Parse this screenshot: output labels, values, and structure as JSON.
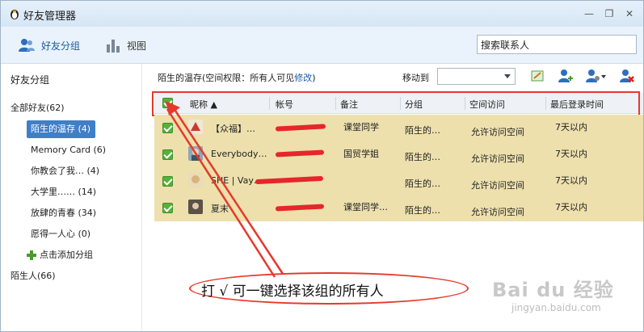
{
  "window": {
    "title": "好友管理器",
    "minimize": "—",
    "maximize": "❐",
    "close": "✕"
  },
  "toolbar": {
    "friends_group": "好友分组",
    "view": "视图",
    "search_placeholder": "搜索联系人"
  },
  "sidebar": {
    "heading": "好友分组",
    "all_friends": "全部好友(62)",
    "groups": [
      {
        "label": "陌生的温存 (4)"
      },
      {
        "label": "Memory  Card (6)"
      },
      {
        "label": "你教会了我… (4)"
      },
      {
        "label": "大学里…… (14)"
      },
      {
        "label": "放肆的青春 (34)"
      },
      {
        "label": "愿得一人心 (0)"
      }
    ],
    "add_group": "点击添加分组",
    "strangers": "陌生人(66)"
  },
  "group_bar": {
    "info_prefix": "陌生的温存(空间权限：所有人可见",
    "info_link": "修改",
    "info_suffix": ")",
    "move_to": "移动到",
    "move_value": ""
  },
  "table": {
    "columns": [
      "昵称 ▲",
      "帐号",
      "备注",
      "分组",
      "空间访问",
      "最后登录时间"
    ],
    "rows": [
      {
        "nickname": "【众福】…",
        "account": "",
        "remark": "课堂同学",
        "group": "陌生的…",
        "access": "允许访问空间",
        "last_login": "7天以内"
      },
      {
        "nickname": "Everybody…",
        "account": "",
        "remark": "国贸学姐",
        "group": "陌生的…",
        "access": "允许访问空间",
        "last_login": "7天以内"
      },
      {
        "nickname": "SHE | Vay…",
        "account": "",
        "remark": "",
        "group": "陌生的…",
        "access": "允许访问空间",
        "last_login": "7天以内"
      },
      {
        "nickname": "夏末",
        "account": "",
        "remark": "课堂同学…",
        "group": "陌生的…",
        "access": "允许访问空间",
        "last_login": "7天以内"
      }
    ]
  },
  "annotation": {
    "text": "打 √ 可一键选择该组的所有人"
  },
  "watermark": {
    "brand": "Bai du 经验",
    "url": "jingyan.baidu.com"
  },
  "colors": {
    "accent": "#3f7fc8",
    "row_highlight": "#ede0ad",
    "annotation_red": "#e43a2c",
    "checkbox_green": "#56b13a"
  }
}
